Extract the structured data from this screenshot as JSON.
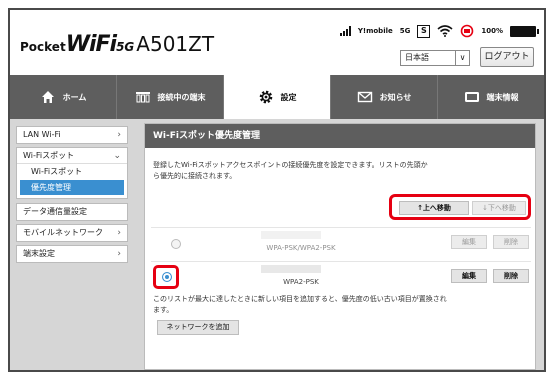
{
  "header": {
    "logo": {
      "pocket": "Pocket",
      "wifi": "WiFi",
      "fiveg": "5G",
      "model": "A501ZT"
    },
    "status": {
      "carrier": "Y!mobile",
      "network": "5G",
      "sim_label": "S",
      "battery": "100%"
    },
    "language": "日本語",
    "logout_label": "ログアウト"
  },
  "nav": [
    {
      "label": "ホーム",
      "icon": "home-icon",
      "active": false
    },
    {
      "label": "接続中の端末",
      "icon": "devices-icon",
      "active": false
    },
    {
      "label": "設定",
      "icon": "gear-icon",
      "active": true
    },
    {
      "label": "お知らせ",
      "icon": "mail-icon",
      "active": false
    },
    {
      "label": "端末情報",
      "icon": "device-info-icon",
      "active": false
    }
  ],
  "sidebar": {
    "lan_wifi": "LAN Wi-Fi",
    "wifi_spot": "Wi-Fiスポット",
    "wifi_spot_sub": "Wi-Fiスポット",
    "priority": "優先度管理",
    "data_settings": "データ通信量設定",
    "mobile_network": "モバイルネットワーク",
    "device_settings": "端末設定"
  },
  "main": {
    "title": "Wi-Fiスポット優先度管理",
    "description": "登録したWi-Fiスポットアクセスポイントの接続優先度を設定できます。リストの先頭から優先的に接続されます。",
    "move_up": "↑上へ移動",
    "move_down": "↓下へ移動",
    "rows": [
      {
        "security": "WPA-PSK/WPA2-PSK",
        "selected": false,
        "edit": "編集",
        "delete": "削除"
      },
      {
        "security": "WPA2-PSK",
        "selected": true,
        "edit": "編集",
        "delete": "削除"
      }
    ],
    "note": "このリストが最大に達したときに新しい項目を追加すると、優先度の低い古い項目が置換されます。",
    "add_network": "ネットワークを追加"
  },
  "colors": {
    "highlight": "#e60012",
    "accent": "#3a8fd0",
    "nav_bg": "#5e5e5e"
  }
}
